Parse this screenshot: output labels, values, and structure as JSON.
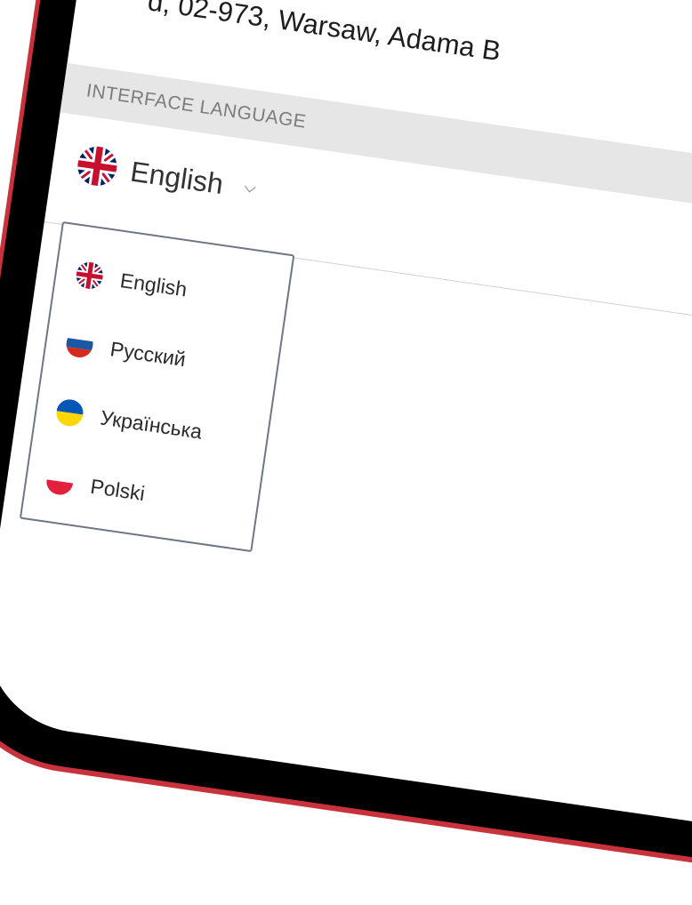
{
  "profile": {
    "address_fragment": "d, 02-973, Warsaw, Adama B"
  },
  "language": {
    "section_title": "INTERFACE LANGUAGE",
    "selected": {
      "label": "English",
      "flag": "uk-flag-icon"
    },
    "options": [
      {
        "label": "English",
        "flag": "uk-flag-icon"
      },
      {
        "label": "Русский",
        "flag": "russia-flag-icon"
      },
      {
        "label": "Українська",
        "flag": "ukraine-flag-icon"
      },
      {
        "label": "Polski",
        "flag": "poland-flag-icon"
      }
    ]
  },
  "colors": {
    "device_frame": "#c8323d",
    "bezel": "#000000",
    "section_header_bg": "#e6e6e6",
    "dropdown_border": "#6e7785"
  }
}
